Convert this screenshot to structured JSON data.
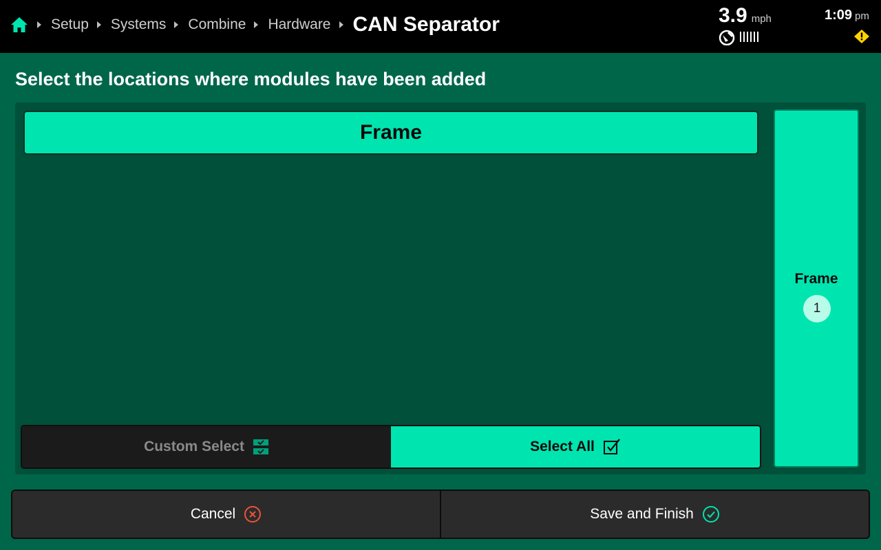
{
  "header": {
    "breadcrumb": [
      "Setup",
      "Systems",
      "Combine",
      "Hardware"
    ],
    "title": "CAN Separator",
    "speed": "3.9",
    "speed_unit": "mph",
    "time": "1:09",
    "ampm": "pm"
  },
  "page": {
    "heading": "Select the locations where modules have been added"
  },
  "panel": {
    "frame_header": "Frame",
    "custom_select_label": "Custom Select",
    "select_all_label": "Select All",
    "side_tab": {
      "label": "Frame",
      "count": "1"
    }
  },
  "footer": {
    "cancel_label": "Cancel",
    "save_label": "Save and Finish"
  },
  "icons": {
    "home": "home-icon",
    "gps": "gps-satellite-icon",
    "signal": "signal-bars-icon",
    "warning": "warning-icon",
    "custom_select": "custom-select-icon",
    "select_all": "checkbox-check-icon",
    "cancel": "cancel-circle-x-icon",
    "save": "check-circle-icon"
  },
  "colors": {
    "accent": "#00e5b0",
    "background": "#00664a",
    "panel": "#00503a",
    "topbar": "#000000",
    "warning": "#ffd400",
    "cancel_icon": "#f0523a"
  }
}
